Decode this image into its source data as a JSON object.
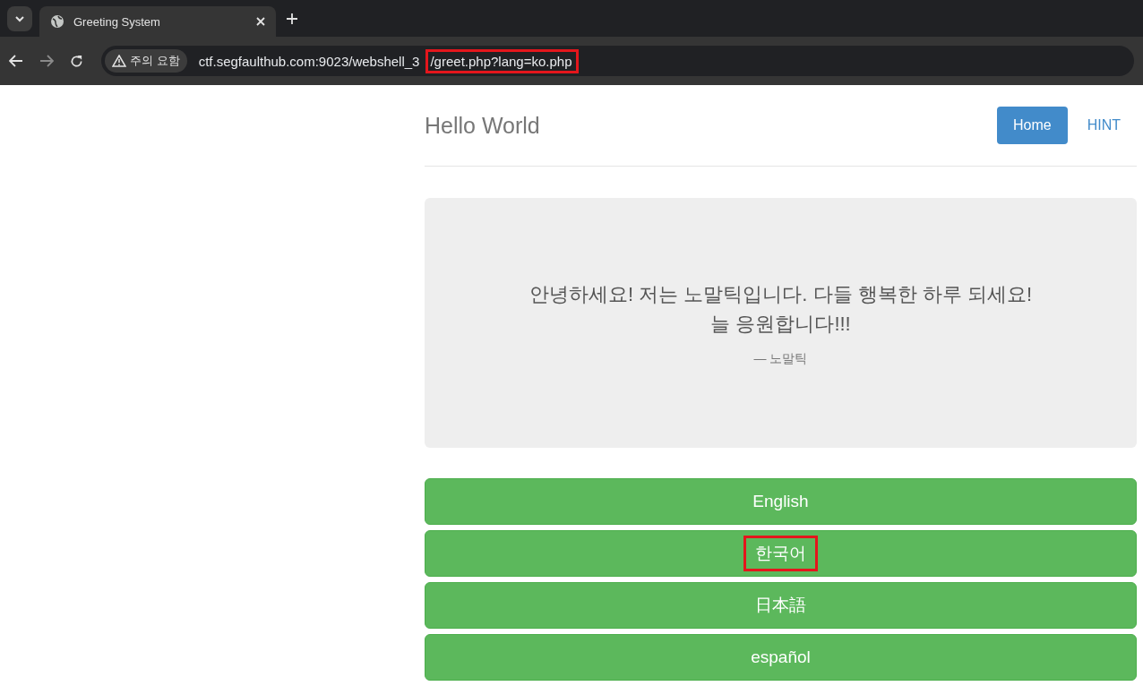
{
  "browser": {
    "tab_title": "Greeting System",
    "security_label": "주의 요함",
    "url_parts": [
      {
        "text": "ctf.segfaulthub.com:9023/webshell_3",
        "highlighted": false
      },
      {
        "text": "/greet.php?lang=ko.php",
        "highlighted": true
      }
    ]
  },
  "header": {
    "title": "Hello World",
    "nav": [
      {
        "label": "Home",
        "selected": true
      },
      {
        "label": "HINT",
        "selected": false
      }
    ]
  },
  "quote": {
    "text": "안녕하세요! 저는 노말틱입니다. 다들 행복한 하루 되세요! 늘 응원합니다!!!",
    "author": "— 노말틱"
  },
  "languages": [
    {
      "label": "English",
      "highlighted": false
    },
    {
      "label": "한국어",
      "highlighted": true
    },
    {
      "label": "日本語",
      "highlighted": false
    },
    {
      "label": "español",
      "highlighted": false
    }
  ]
}
